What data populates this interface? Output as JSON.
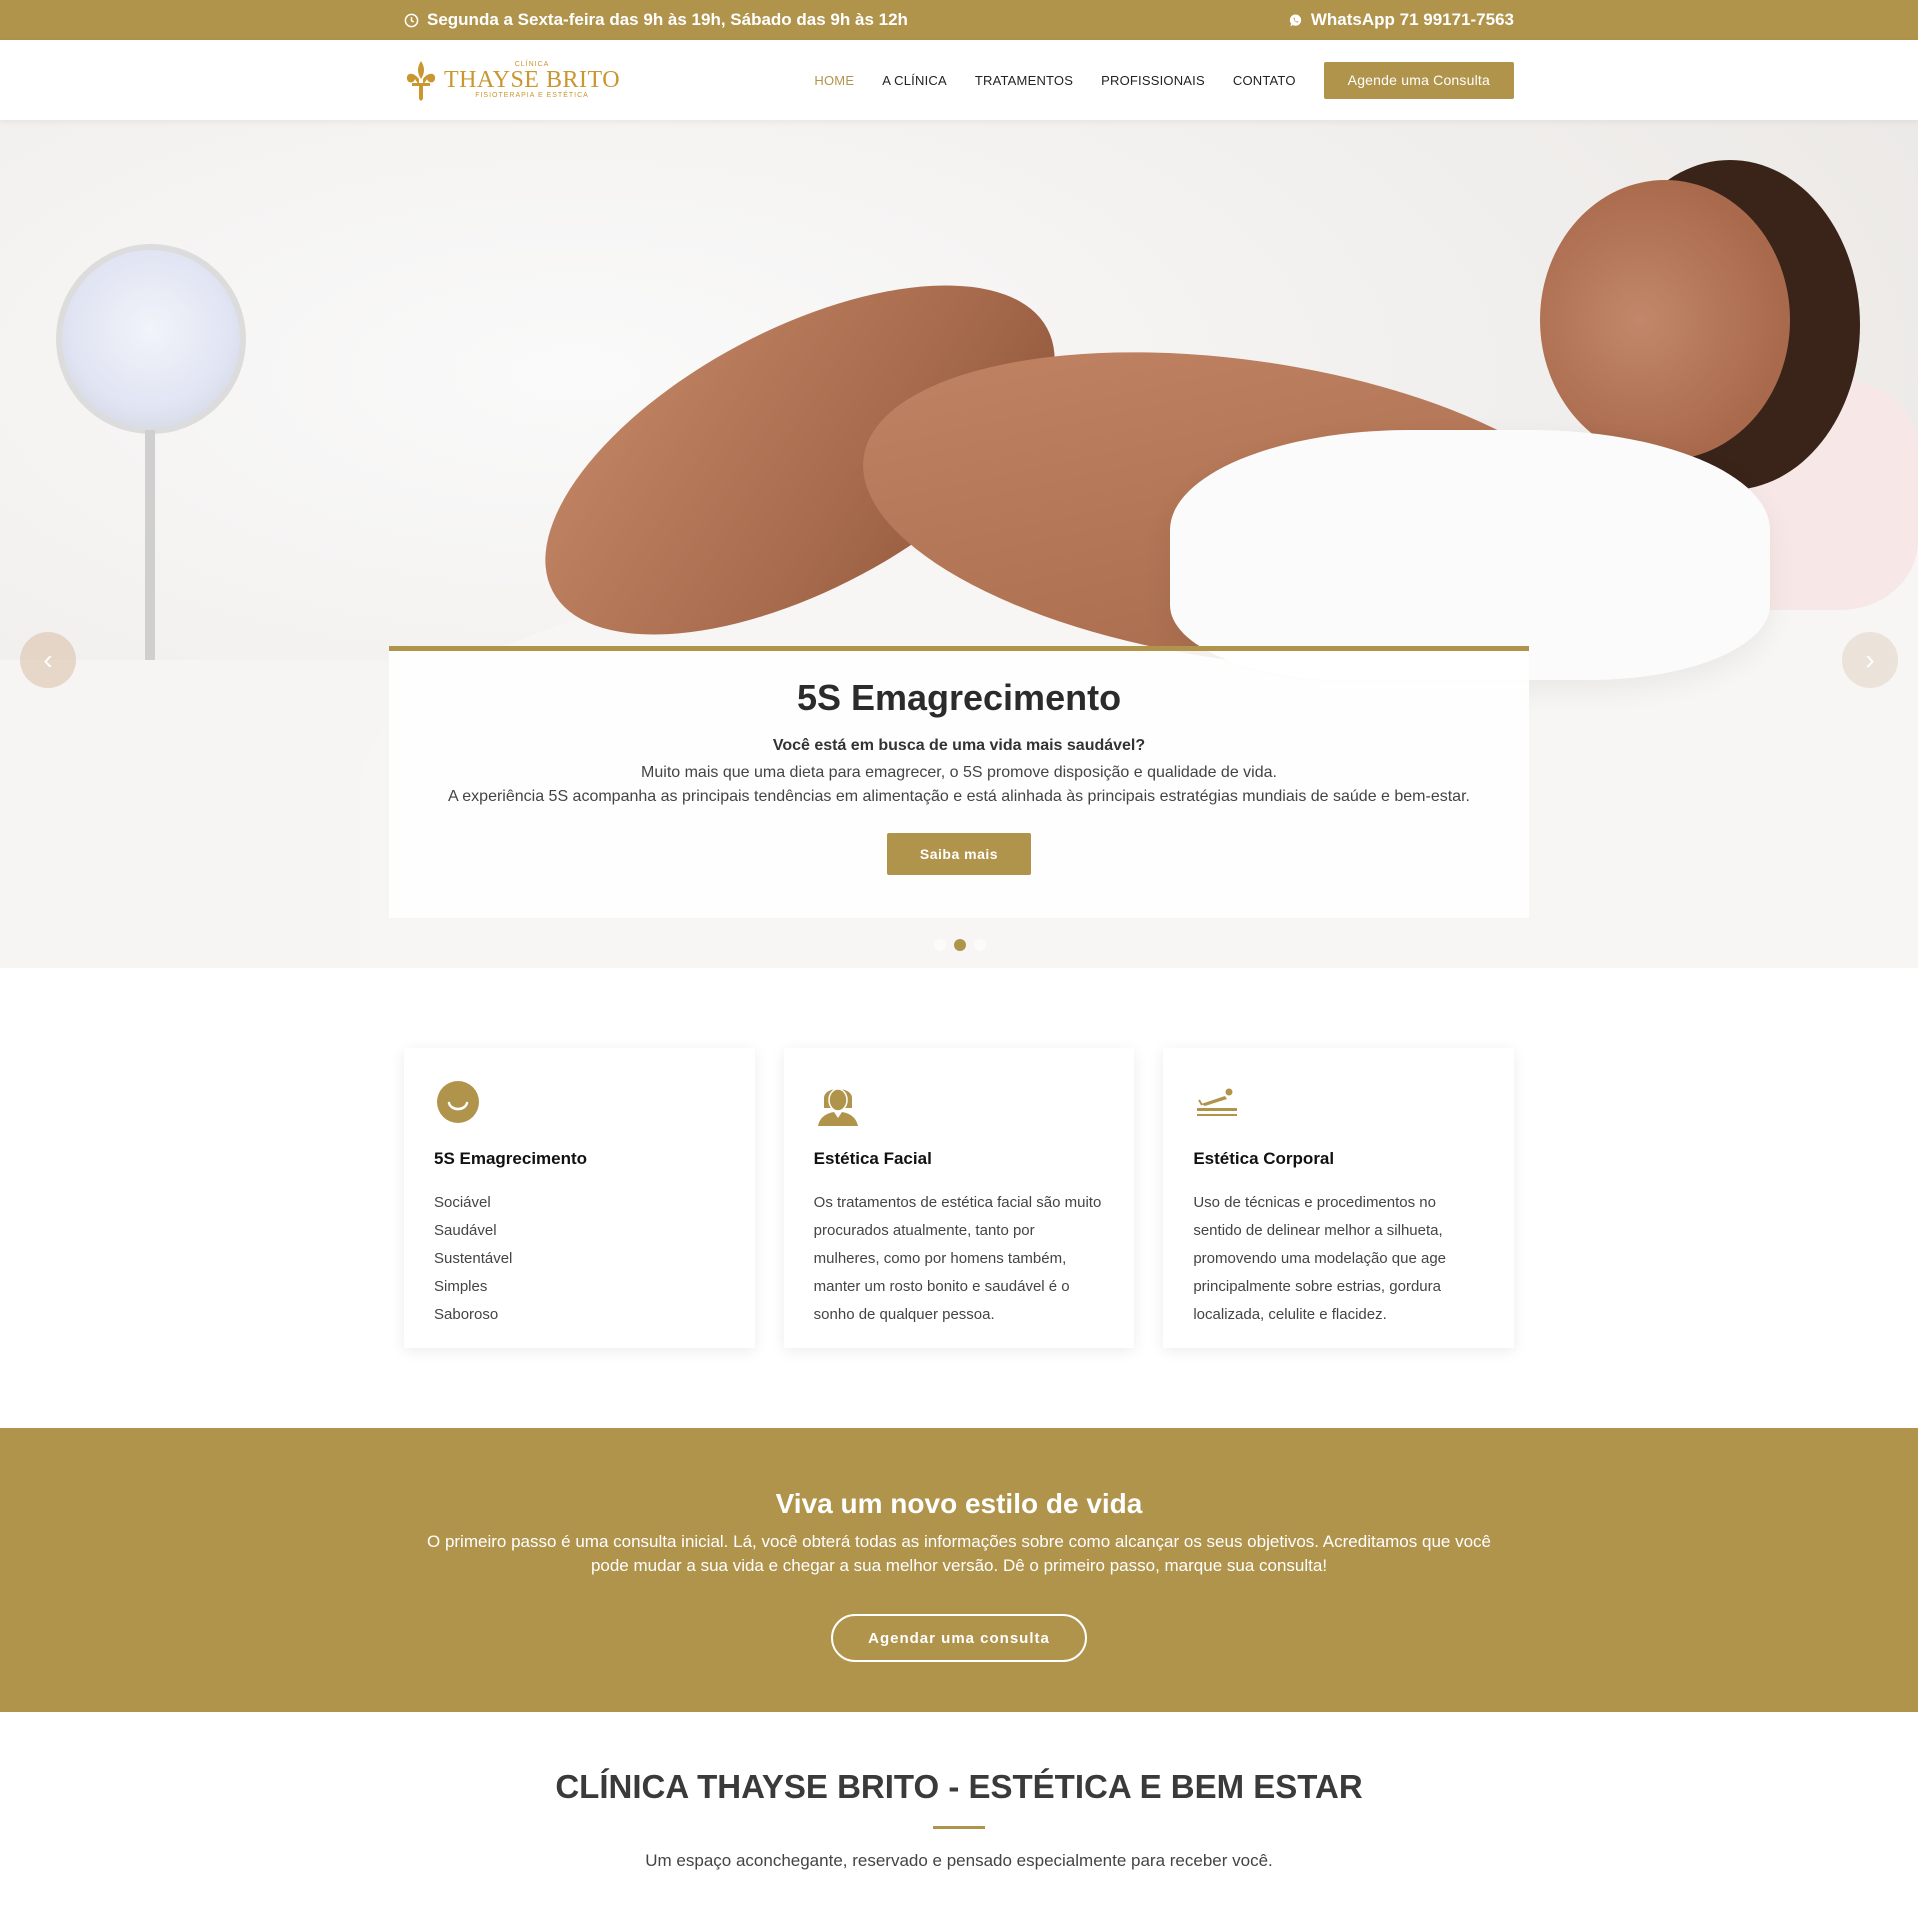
{
  "topbar": {
    "hours": "Segunda a Sexta-feira das 9h às 19h, Sábado das 9h às 12h",
    "whatsapp": "WhatsApp 71 99171-7563"
  },
  "logo": {
    "small": "CLÍNICA",
    "name": "THAYSE BRITO",
    "sub": "FISIOTERAPIA E ESTÉTICA"
  },
  "nav": {
    "items": [
      {
        "label": "HOME",
        "active": true
      },
      {
        "label": "A CLÍNICA"
      },
      {
        "label": "TRATAMENTOS"
      },
      {
        "label": "PROFISSIONAIS"
      },
      {
        "label": "CONTATO"
      }
    ],
    "cta": "Agende uma Consulta"
  },
  "hero": {
    "title": "5S Emagrecimento",
    "lead": "Você está em busca de uma vida mais saudável?",
    "line1": "Muito mais que uma dieta para emagrecer, o 5S promove disposição e qualidade de vida.",
    "line2": "A experiência 5S acompanha as principais tendências em alimentação e está alinhada às principais estratégias mundiais de saúde e bem-estar.",
    "button": "Saiba mais",
    "slides": 3,
    "active_slide": 2
  },
  "cards": [
    {
      "icon": "smile-icon",
      "title": "5S Emagrecimento",
      "list": [
        "Sociável",
        "Saudável",
        "Sustentável",
        "Simples",
        "Saboroso"
      ]
    },
    {
      "icon": "woman-face-icon",
      "title": "Estética Facial",
      "text": "Os tratamentos de estética facial são muito procurados atualmente, tanto por mulheres, como por homens também, manter um rosto bonito e saudável é o sonho de qualquer pessoa."
    },
    {
      "icon": "massage-table-icon",
      "title": "Estética Corporal",
      "text": "Uso de técnicas e procedimentos no sentido de delinear melhor a silhueta, promovendo uma modelação que age principalmente sobre estrias, gordura localizada, celulite e flacidez."
    }
  ],
  "band": {
    "title": "Viva um novo estilo de vida",
    "text": "O primeiro passo é uma consulta inicial. Lá, você obterá todas as informações sobre como alcançar os seus objetivos. Acreditamos que você pode mudar a sua vida e chegar a sua melhor versão. Dê o primeiro passo, marque sua consulta!",
    "button": "Agendar uma consulta"
  },
  "about": {
    "title": "CLÍNICA THAYSE BRITO - ESTÉTICA E BEM ESTAR",
    "text": "Um espaço aconchegante, reservado e pensado especialmente para receber você."
  },
  "colors": {
    "accent": "#b1944c",
    "logo": "#c9962f"
  }
}
